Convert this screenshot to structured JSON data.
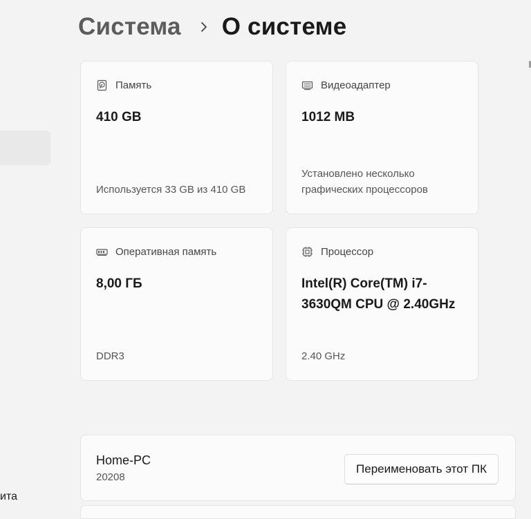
{
  "breadcrumb": {
    "parent": "Система",
    "current": "О системе"
  },
  "sidebar": {
    "bottom_item_partial": "ита"
  },
  "cards": {
    "storage": {
      "title": "Память",
      "icon": "hard-drive-icon",
      "value": "410 GB",
      "detail": "Используется 33 GB из 410 GB"
    },
    "gpu": {
      "title": "Видеоадаптер",
      "icon": "display-adapter-icon",
      "value": "1012 MB",
      "detail": "Установлено несколько графических процессоров"
    },
    "ram": {
      "title": "Оперативная память",
      "icon": "memory-module-icon",
      "value": "8,00 ГБ",
      "detail": "DDR3"
    },
    "cpu": {
      "title": "Процессор",
      "icon": "processor-chip-icon",
      "value": "Intel(R) Core(TM) i7-3630QM CPU @ 2.40GHz",
      "detail": "2.40 GHz"
    }
  },
  "pc": {
    "name": "Home-PC",
    "sub": "20208",
    "rename_label": "Переименовать этот ПК"
  },
  "colors": {
    "background": "#f3f3f3",
    "card": "#fbfbfb",
    "border": "#e5e5e5",
    "breadcrumb_parent": "#5c5c5c"
  }
}
